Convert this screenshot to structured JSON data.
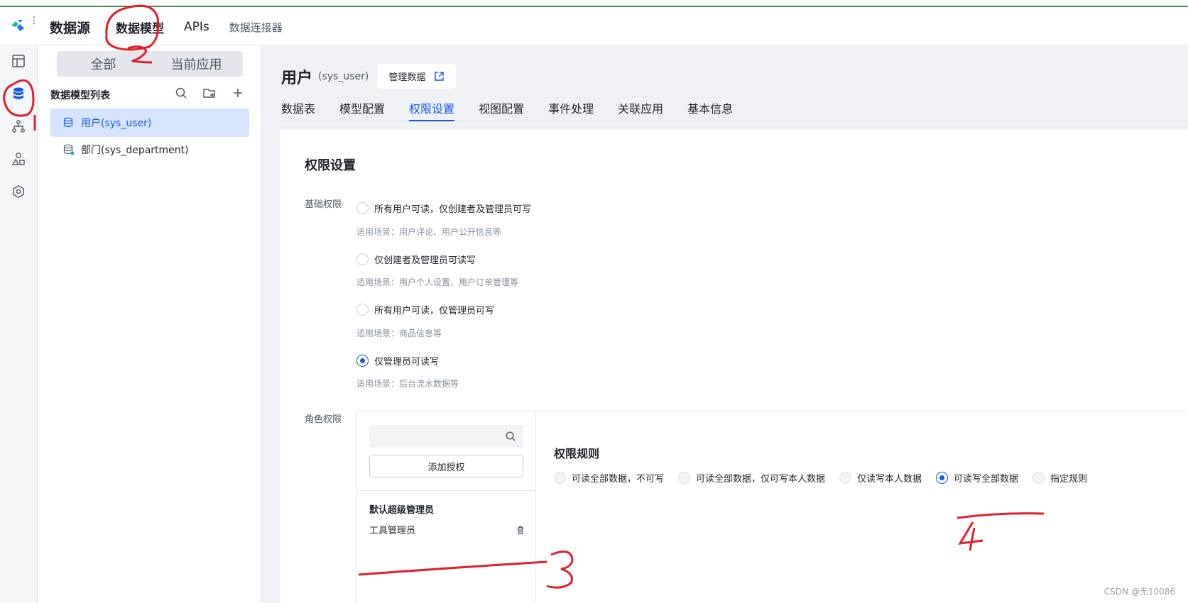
{
  "topbar": {
    "title": "数据源",
    "tabs": [
      "数据模型",
      "APIs",
      "数据连接器"
    ]
  },
  "rail": {
    "icons": [
      "layout-icon",
      "database-icon",
      "flow-icon",
      "shapes-icon",
      "settings-icon"
    ]
  },
  "side": {
    "segments": [
      "全部",
      "当前应用"
    ],
    "list_title": "数据模型列表",
    "models": [
      "用户(sys_user)",
      "部门(sys_department)"
    ]
  },
  "main": {
    "title": "用户",
    "subtitle": "(sys_user)",
    "manage_label": "管理数据",
    "tabs": [
      "数据表",
      "模型配置",
      "权限设置",
      "视图配置",
      "事件处理",
      "关联应用",
      "基本信息"
    ],
    "active_tab": "权限设置",
    "card_title": "权限设置",
    "basic_label": "基础权限",
    "basic_options": [
      {
        "label": "所有用户可读，仅创建者及管理员可写",
        "hint": "适用场景：用户评论、用户公开信息等",
        "checked": false
      },
      {
        "label": "仅创建者及管理员可读写",
        "hint": "适用场景：用户个人设置、用户订单管理等",
        "checked": false
      },
      {
        "label": "所有用户可读，仅管理员可写",
        "hint": "适用场景：商品信息等",
        "checked": false
      },
      {
        "label": "仅管理员可读写",
        "hint": "适用场景：后台流水数据等",
        "checked": true
      }
    ],
    "role_label": "角色权限",
    "add_auth": "添加授权",
    "role_group": "默认超级管理员",
    "role_item": "工具管理员",
    "rule_title": "权限规则",
    "rules": [
      {
        "label": "可读全部数据，不可写",
        "checked": false
      },
      {
        "label": "可读全部数据，仅可写本人数据",
        "checked": false
      },
      {
        "label": "仅读写本人数据",
        "checked": false
      },
      {
        "label": "可读写全部数据",
        "checked": true
      },
      {
        "label": "指定规则",
        "checked": false
      }
    ]
  },
  "watermark": "CSDN @无10086",
  "colors": {
    "accent": "#1456f0",
    "annotation": "#e0202a"
  }
}
